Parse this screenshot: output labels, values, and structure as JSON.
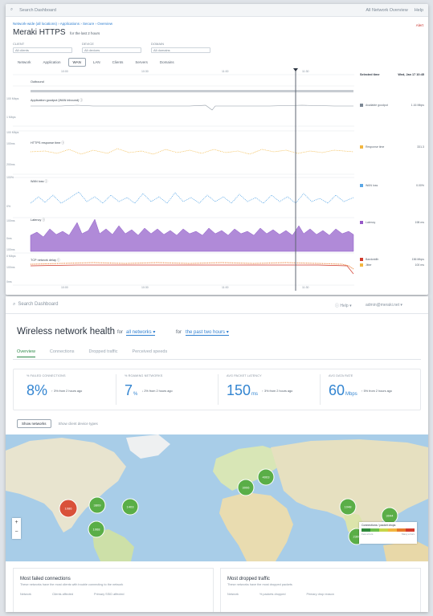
{
  "dashboard": {
    "topbar": {
      "search": "Search Dashboard",
      "right1": "All Network Overview",
      "right2": "Help"
    },
    "breadcrumb": "Network-wide (all locations) › Applications › Secure › Overview",
    "title": "Meraki HTTPS",
    "subtitle": "for the last 2 hours",
    "flag": "Alert",
    "filters": [
      {
        "label": "CLIENT",
        "value": "All clients"
      },
      {
        "label": "DEVICE",
        "value": "All devices"
      },
      {
        "label": "DOMAIN",
        "value": "All domains"
      }
    ],
    "subtabs": [
      "Network",
      "Application",
      "WAN",
      "LAN",
      "Clients",
      "Servers",
      "Domains"
    ],
    "active_subtab": "WAN",
    "plot_labels": [
      "Outbound",
      "Application goodput (WAN inbound) ⓘ",
      "HTTPS response time ⓘ",
      "WAN loss ⓘ",
      "Latency ⓘ",
      "TCP network delay ⓘ"
    ],
    "y_labels": [
      "100 Mbps",
      "1 Mbps",
      "100 Mbps",
      "100ms",
      "200ms",
      "100%",
      "0%",
      "100ms",
      "0ms",
      "100ms",
      "0 Mbps",
      "100ms",
      "0ms"
    ],
    "x_labels": [
      "10:00",
      "10:30",
      "11:00",
      "11:30"
    ],
    "legend_head": {
      "left": "Selected time",
      "right": "Wed, Jan 17 10:45"
    },
    "legend": [
      {
        "label": "Available goodput",
        "value": "1.16 Mbps",
        "color": "#7b8794"
      },
      {
        "label": "Response time",
        "value": "331.3",
        "color": "#f2b640"
      },
      {
        "label": "WAN loss",
        "value": "0.00%",
        "color": "#5aa7e6"
      },
      {
        "label": "Latency",
        "value": "198 ms",
        "color": "#9658c8"
      },
      {
        "label": "Bandwidth",
        "value": "156 Mbps",
        "color": "#d23a2c"
      },
      {
        "label": "Jitter",
        "value": "100 ms",
        "color": "#f2b640"
      }
    ]
  },
  "wireless": {
    "search": {
      "placeholder": "Search Dashboard",
      "help": "Help",
      "user": "admin@meraki.net"
    },
    "title": "Wireless network health",
    "for1": "for",
    "sel1": "all networks",
    "for2": "for",
    "sel2": "the past two hours",
    "tabs": [
      "Overview",
      "Connections",
      "Dropped traffic",
      "Perceived speeds"
    ],
    "stats": [
      {
        "label": "% FAILED CONNECTIONS",
        "value": "8%",
        "unit": "",
        "change": "↑ 3% from 2 hours ago"
      },
      {
        "label": "% ROAMING NETWORKS",
        "value": "7",
        "unit": "%",
        "change": "↓ 2% from 2 hours ago"
      },
      {
        "label": "AVG PACKET LATENCY",
        "value": "150",
        "unit": "ms",
        "change": "↑ 3% from 2 hours ago"
      },
      {
        "label": "AVG DATA RATE",
        "value": "60",
        "unit": "Mbps",
        "change": "↑ 5% from 2 hours ago"
      }
    ],
    "buttons": {
      "primary": "Show networks",
      "secondary": "Show client device types"
    },
    "map_clusters": [
      {
        "label": "1086",
        "color": "#d9513a"
      },
      {
        "label": "3809",
        "color": "#5aae47"
      },
      {
        "label": "1068",
        "color": "#5aae47"
      },
      {
        "label": "1403",
        "color": "#5aae47"
      },
      {
        "label": "3006",
        "color": "#5aae47"
      },
      {
        "label": "4003",
        "color": "#5aae47"
      },
      {
        "label": "1048",
        "color": "#5aae47"
      },
      {
        "label": "3044",
        "color": "#5aae47"
      },
      {
        "label": "2300",
        "color": "#5aae47"
      }
    ],
    "map_legend": {
      "title": "Connections / packet drops",
      "low": "Few errors",
      "high": "Many errors"
    },
    "panels": [
      {
        "title": "Most failed connections",
        "subtitle": "These networks have the most clients with trouble connecting to the network",
        "cols": [
          "Network",
          "Clients affected",
          "Primary SSID affected"
        ]
      },
      {
        "title": "Most dropped traffic",
        "subtitle": "These networks have the most dropped packets",
        "cols": [
          "Network",
          "% packets dropped",
          "Primary drop reason"
        ]
      }
    ]
  }
}
